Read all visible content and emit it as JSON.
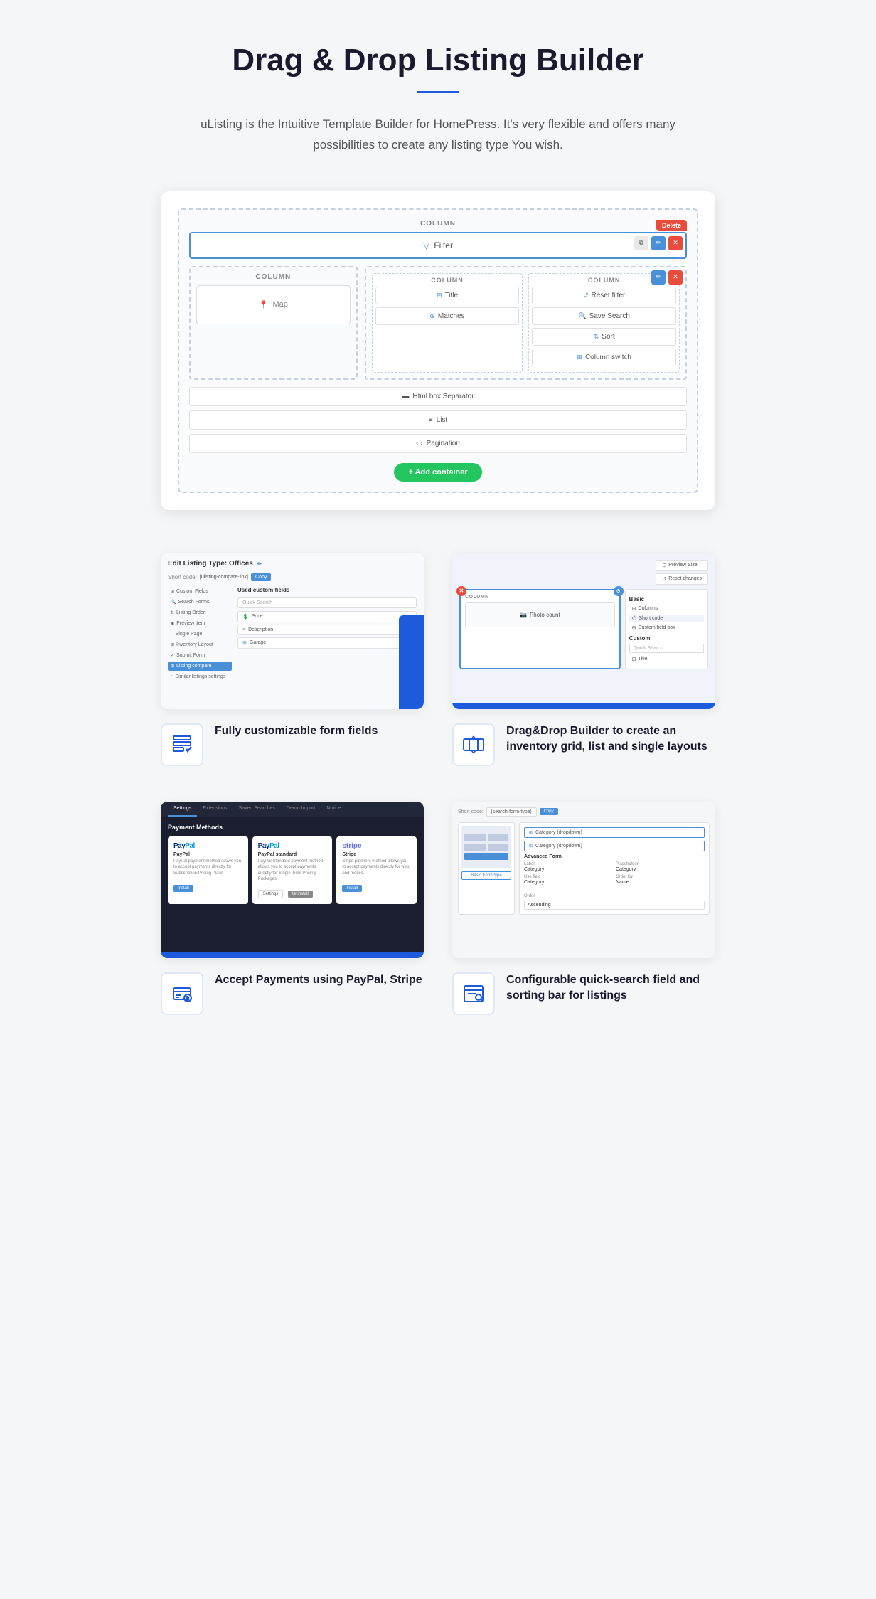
{
  "header": {
    "title": "Drag & Drop Listing Builder",
    "subtitle": "uListing is the Intuitive Template Builder for HomePress. It's very flexible and offers many possibilities to create any listing type You wish."
  },
  "builder": {
    "column_label": "COLUMN",
    "delete_label": "Delete",
    "filter_label": "Filter",
    "map_label": "Map",
    "title_label": "Title",
    "matches_label": "Matches",
    "reset_filter_label": "Reset filter",
    "save_search_label": "Save Search",
    "sort_label": "Sort",
    "column_switch_label": "Column switch",
    "html_box_label": "Html box Separator",
    "list_label": "List",
    "pagination_label": "Pagination",
    "add_container_label": "+ Add container"
  },
  "features": [
    {
      "id": "custom-fields",
      "title": "Fully customizable form fields",
      "screenshot_type": "edit-listing"
    },
    {
      "id": "drag-drop",
      "title": "Drag&Drop Builder to create an inventory grid, list and single layouts",
      "screenshot_type": "drag-drop-builder"
    },
    {
      "id": "payments",
      "title": "Accept Payments using PayPal, Stripe",
      "screenshot_type": "payment-methods"
    },
    {
      "id": "search-form",
      "title": "Configurable quick-search field and sorting bar for listings",
      "screenshot_type": "search-form"
    }
  ],
  "edit_listing": {
    "title": "Edit Listing Type: Offices",
    "short_code_label": "Short code:",
    "short_code_value": "[ulisting-compare-link]",
    "copy_label": "Copy",
    "sidebar_items": [
      "Custom Fields",
      "Search Forms",
      "Listing Order",
      "Preview item",
      "Single Page",
      "Inventory Layout",
      "Submit Form",
      "Listing compare",
      "Similar listings settings"
    ],
    "active_sidebar_item": "Listing compare",
    "content_title": "Used custom fields",
    "search_placeholder": "Quick Search",
    "custom_fields": [
      "Price",
      "Description",
      "Garage"
    ]
  },
  "drag_drop": {
    "preview_size_label": "Preview Size",
    "reset_changes_label": "Reset changes",
    "canvas_label": "COLUMN",
    "photo_count_label": "Photo count",
    "panel_sections": {
      "basic": "Basic",
      "custom": "Custom"
    },
    "panel_basic_items": [
      "Columns",
      "Short code",
      "Custom field box"
    ],
    "panel_search_placeholder": "Quick Search",
    "panel_custom_items": [
      "Title"
    ]
  },
  "payment_methods": {
    "tabs": [
      "Settings",
      "Extensions",
      "Saved Searches",
      "Demo Import",
      "Notice"
    ],
    "active_tab": "Settings",
    "title": "Payment Methods",
    "methods": [
      {
        "name": "PayPal",
        "logo": "PayPal",
        "description": "PayPal payment method allows you to accept payments directly for Subscription Pricing Plans",
        "action": "Install"
      },
      {
        "name": "PayPal standard",
        "logo": "PayPal",
        "description": "PayPal Standard payment method allows you to accept payments directly for Single-Time Pricing Packages",
        "action_settings": "Settings",
        "action_uninstall": "Uninstall"
      },
      {
        "name": "Stripe",
        "logo": "stripe",
        "description": "Stripe payment method allows you to accept payments directly for web and mobile.",
        "action": "Install"
      }
    ]
  },
  "search_form": {
    "short_code_label": "Short code:",
    "short_code_value": "[search-form-type]",
    "copy_label": "Copy",
    "category_label": "Category (dropdown)",
    "advanced_form_label": "Advanced Form",
    "basic_form_type_label": "Basic Form type",
    "fields": {
      "label_label": "Label",
      "placeholder_label": "Placeholder",
      "label_value": "Category",
      "placeholder_value": "Category",
      "use_field_label": "Use field",
      "use_field_value": "Category",
      "order_by_label": "Order By",
      "order_by_value": "Name",
      "order_label": "Order",
      "order_value": "Ascending"
    }
  },
  "short_code": {
    "label": "Short code"
  }
}
